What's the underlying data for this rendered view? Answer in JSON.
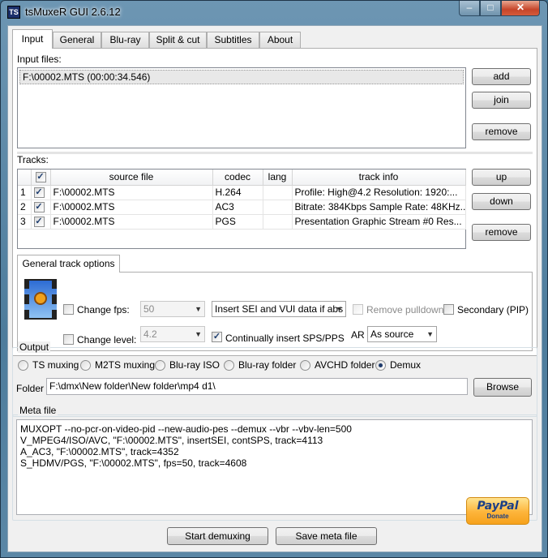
{
  "window": {
    "title": "tsMuxeR GUI 2.6.12",
    "app_icon": "TS",
    "min_glyph": "–",
    "max_glyph": "□",
    "close_glyph": "✕"
  },
  "tabs": [
    "Input",
    "General",
    "Blu-ray",
    "Split & cut",
    "Subtitles",
    "About"
  ],
  "input": {
    "label": "Input files:",
    "files": [
      "F:\\00002.MTS (00:00:34.546)"
    ],
    "buttons": {
      "add": "add",
      "join": "join",
      "remove": "remove"
    }
  },
  "tracks": {
    "label": "Tracks:",
    "columns": [
      "source file",
      "codec",
      "lang",
      "track info"
    ],
    "rows": [
      {
        "num": "1",
        "source": "F:\\00002.MTS",
        "codec": "H.264",
        "lang": "",
        "info": "Profile: High@4.2  Resolution: 1920:..."
      },
      {
        "num": "2",
        "source": "F:\\00002.MTS",
        "codec": "AC3",
        "lang": "",
        "info": "Bitrate: 384Kbps Sample Rate: 48KHz..."
      },
      {
        "num": "3",
        "source": "F:\\00002.MTS",
        "codec": "PGS",
        "lang": "",
        "info": "Presentation Graphic Stream #0 Res..."
      }
    ],
    "buttons": {
      "up": "up",
      "down": "down",
      "remove": "remove"
    }
  },
  "track_options": {
    "tab": "General track options",
    "change_fps": "Change fps:",
    "fps_value": "50",
    "change_level": "Change level:",
    "level_value": "4.2",
    "sei_value": "Insert SEI and VUI data if abs",
    "remove_pulldown": "Remove pulldown",
    "secondary": "Secondary (PIP)",
    "continually_sps": "Continually insert SPS/PPS",
    "ar_label": "AR",
    "ar_value": "As source"
  },
  "output": {
    "label": "Output",
    "options": [
      "TS muxing",
      "M2TS muxing",
      "Blu-ray ISO",
      "Blu-ray folder",
      "AVCHD folder",
      "Demux"
    ],
    "selected": "Demux",
    "folder_label": "Folder",
    "folder_value": "F:\\dmx\\New folder\\New folder\\mp4 d1\\",
    "browse": "Browse"
  },
  "meta": {
    "label": "Meta file",
    "lines": [
      "MUXOPT --no-pcr-on-video-pid --new-audio-pes --demux --vbr  --vbv-len=500",
      "V_MPEG4/ISO/AVC, \"F:\\00002.MTS\", insertSEI, contSPS, track=4113",
      "A_AC3, \"F:\\00002.MTS\", track=4352",
      "S_HDMV/PGS, \"F:\\00002.MTS\", fps=50, track=4608"
    ]
  },
  "footer": {
    "start": "Start demuxing",
    "save_meta": "Save meta file",
    "paypal": "PayPal",
    "donate": "Donate"
  }
}
